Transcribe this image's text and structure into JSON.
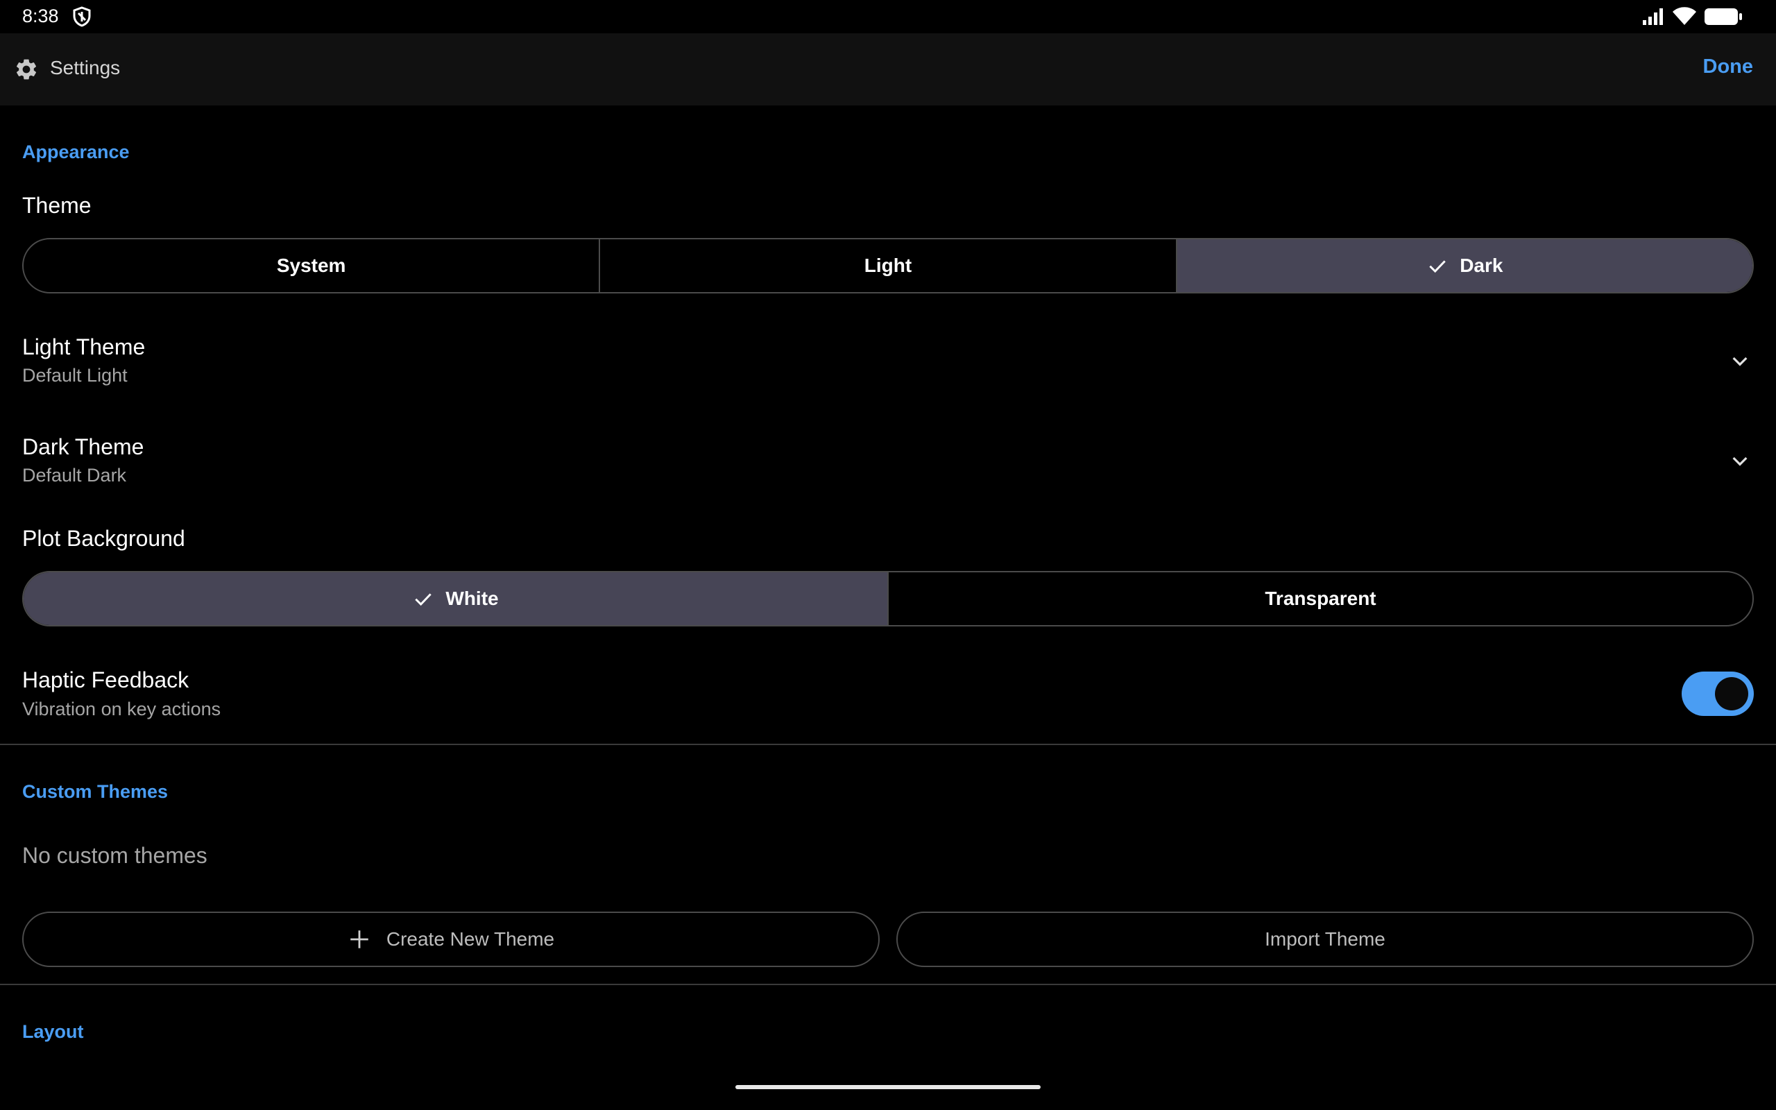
{
  "status_bar": {
    "time": "8:38",
    "icons": [
      "vpn-shield-icon",
      "signal-icon",
      "wifi-icon",
      "battery-icon"
    ]
  },
  "app_bar": {
    "icon": "gear-icon",
    "title": "Settings",
    "done_label": "Done"
  },
  "appearance": {
    "section_title": "Appearance",
    "theme": {
      "label": "Theme",
      "options": [
        "System",
        "Light",
        "Dark"
      ],
      "selected": "Dark"
    },
    "light_theme": {
      "label": "Light Theme",
      "value": "Default Light"
    },
    "dark_theme": {
      "label": "Dark Theme",
      "value": "Default Dark"
    },
    "plot_background": {
      "label": "Plot Background",
      "options": [
        "White",
        "Transparent"
      ],
      "selected": "White"
    },
    "haptic": {
      "label": "Haptic Feedback",
      "subtitle": "Vibration on key actions",
      "enabled": true
    }
  },
  "custom_themes": {
    "section_title": "Custom Themes",
    "empty_text": "No custom themes",
    "create_label": "Create New Theme",
    "import_label": "Import Theme"
  },
  "layout": {
    "section_title": "Layout"
  },
  "colors": {
    "accent": "#4a9df3",
    "selected_segment": "#474556",
    "background": "#000000",
    "app_bar": "#111111"
  }
}
